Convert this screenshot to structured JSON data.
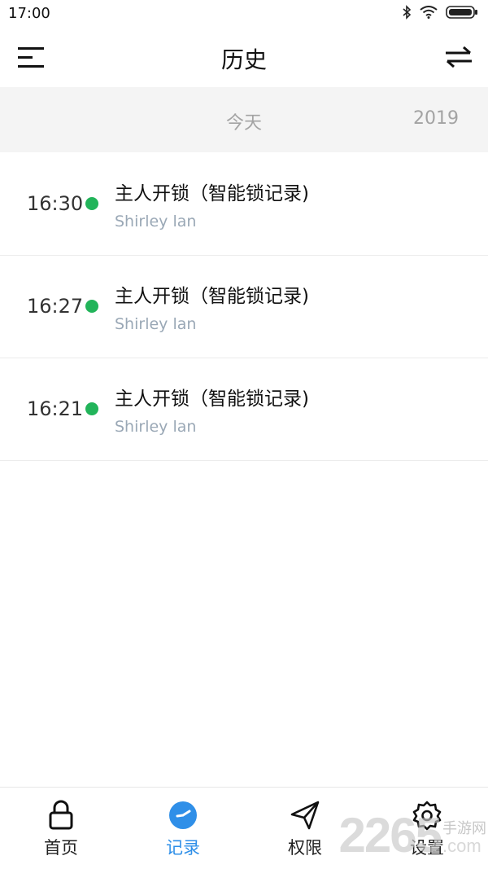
{
  "status_bar": {
    "time": "17:00"
  },
  "header": {
    "title": "历史"
  },
  "date_filter": {
    "today_label": "今天",
    "year_label": "2019"
  },
  "records": [
    {
      "time": "16:30",
      "title": "主人开锁（智能锁记录)",
      "user": "Shirley lan"
    },
    {
      "time": "16:27",
      "title": "主人开锁（智能锁记录)",
      "user": "Shirley lan"
    },
    {
      "time": "16:21",
      "title": "主人开锁（智能锁记录)",
      "user": "Shirley lan"
    }
  ],
  "bottom_nav": {
    "items": [
      {
        "label": "首页",
        "icon": "lock-icon",
        "active": false
      },
      {
        "label": "记录",
        "icon": "clock-icon",
        "active": true
      },
      {
        "label": "权限",
        "icon": "send-icon",
        "active": false
      },
      {
        "label": "设置",
        "icon": "gear-icon",
        "active": false
      }
    ]
  },
  "watermark": {
    "big": "2265",
    "cn": "手游网",
    "com": ".com"
  },
  "colors": {
    "status_dot": "#22b45a",
    "active_tab": "#2f8fe8",
    "secondary_text": "#9aa8b6"
  }
}
